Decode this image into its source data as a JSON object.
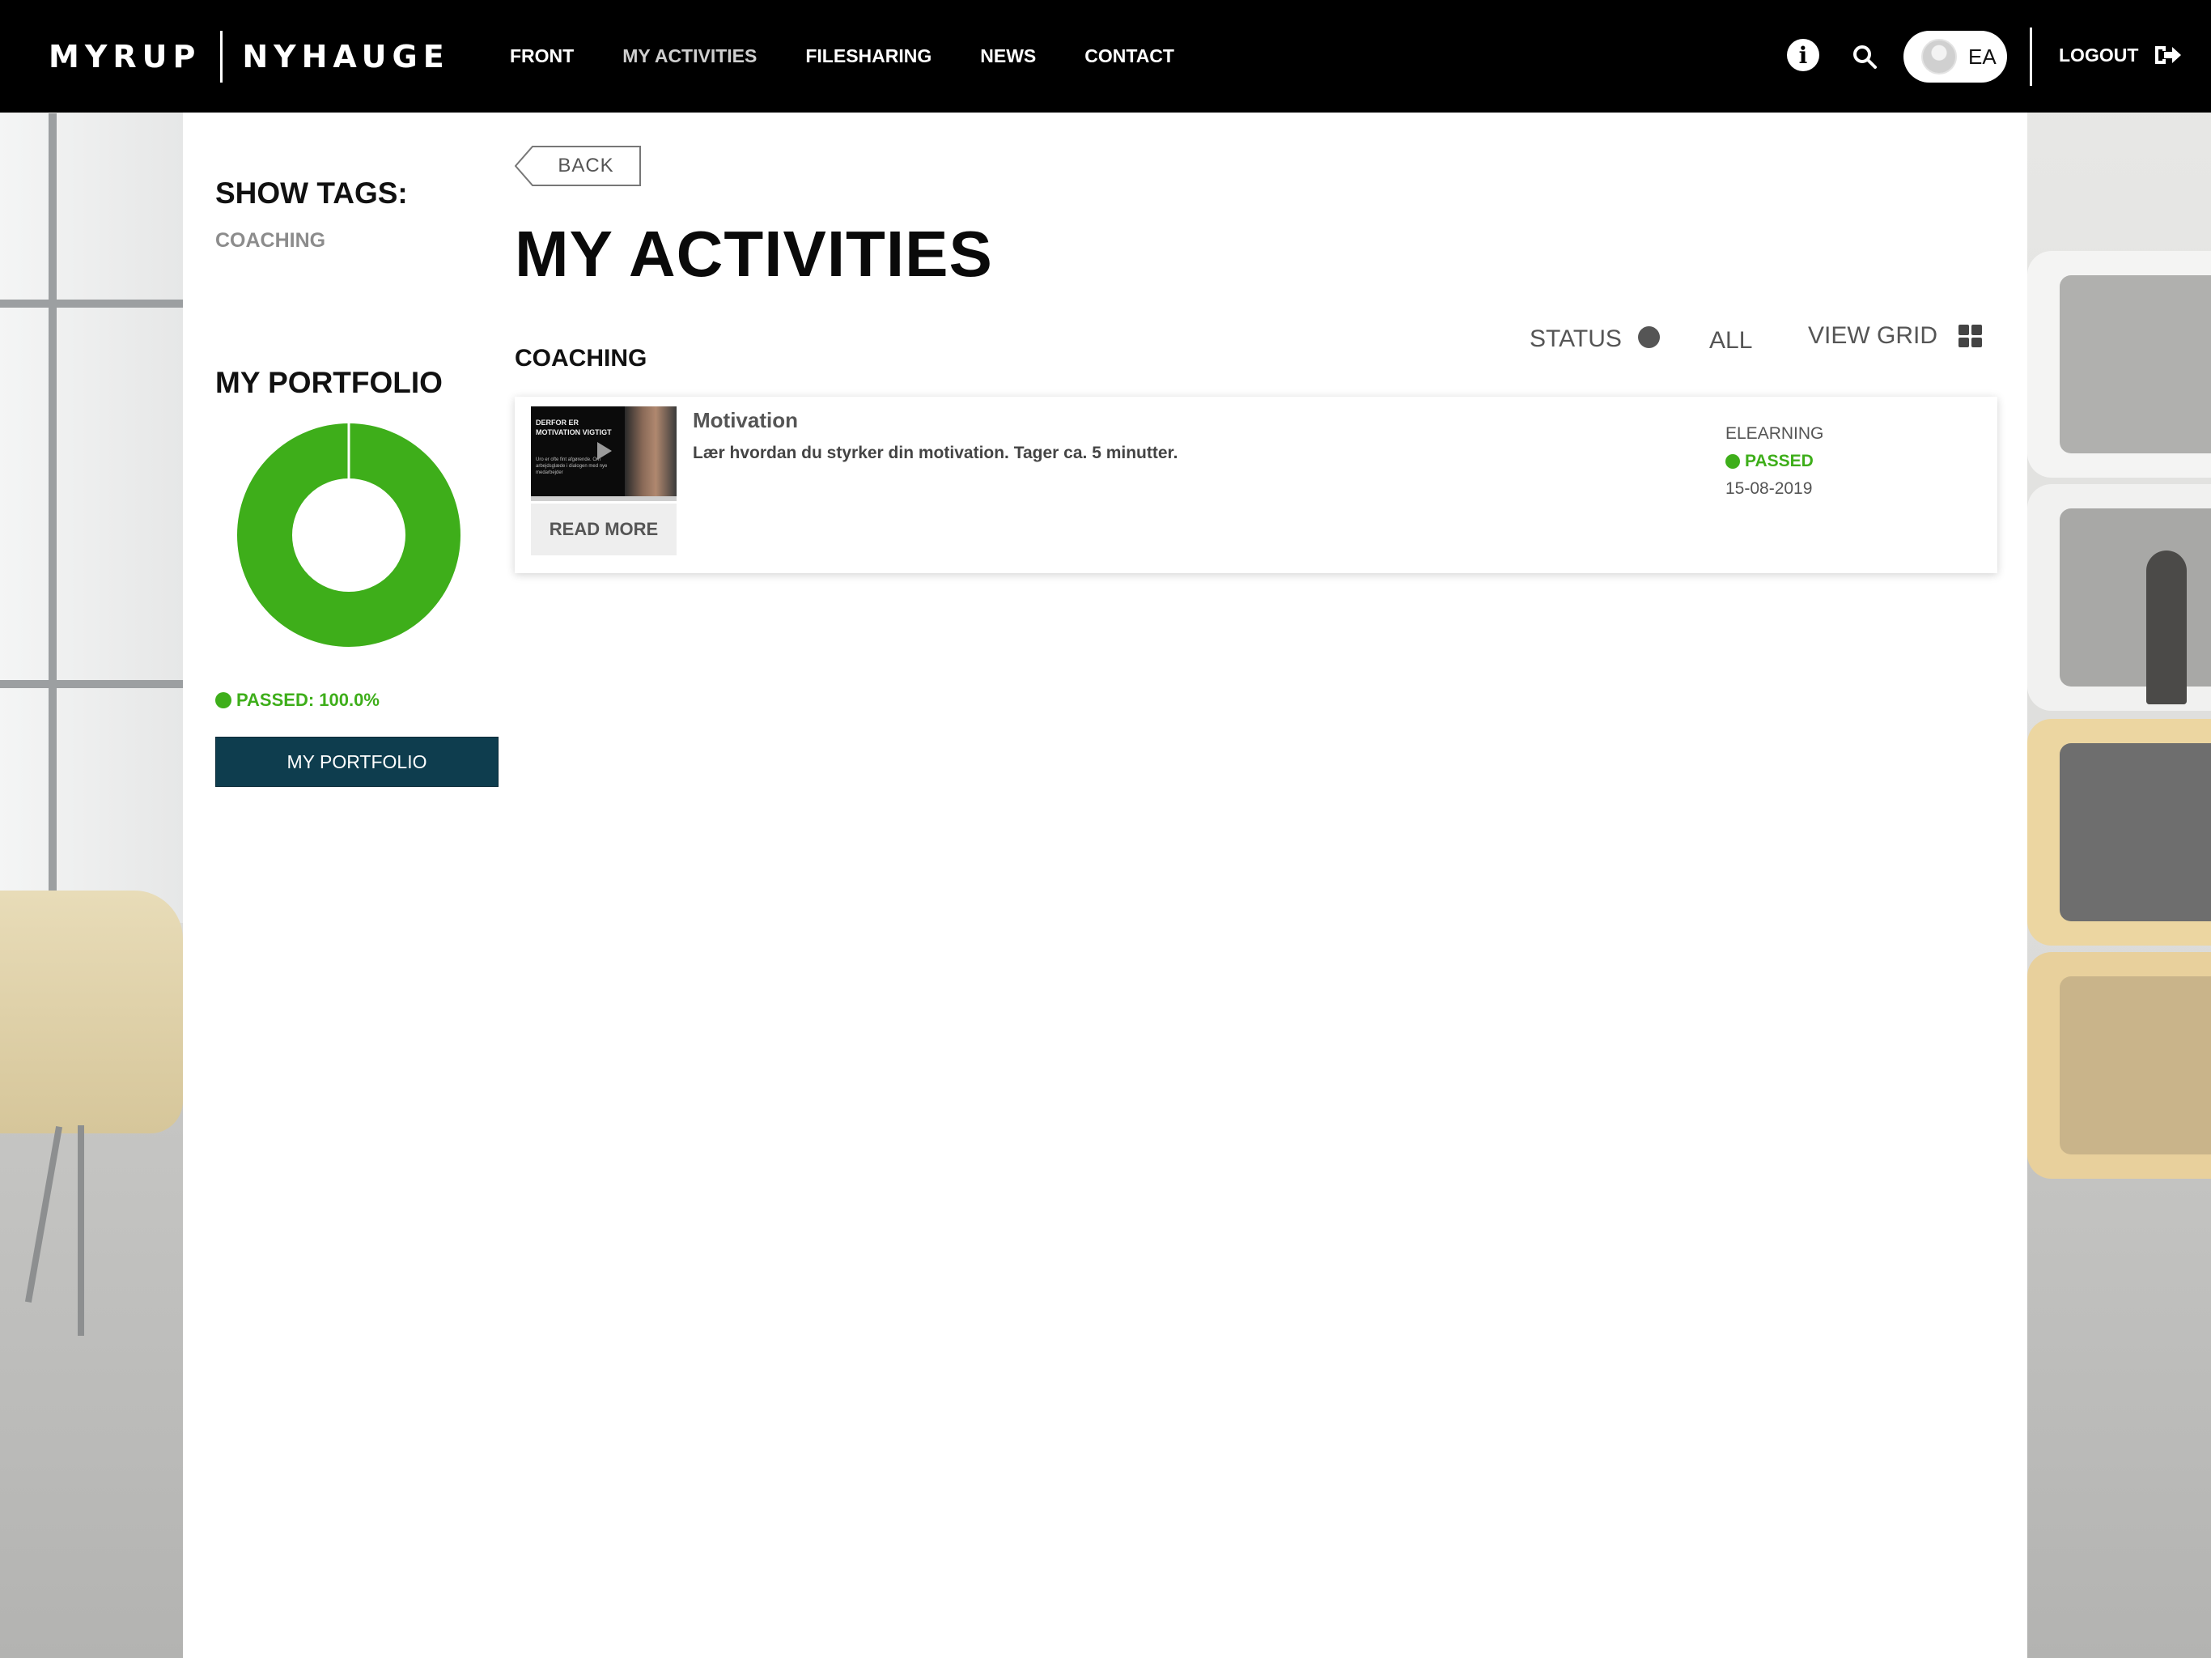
{
  "brand": {
    "left": "MYRUP",
    "right": "NYHAUGE"
  },
  "nav": {
    "items": [
      {
        "label": "FRONT",
        "active": false
      },
      {
        "label": "MY ACTIVITIES",
        "active": true
      },
      {
        "label": "FILESHARING",
        "active": false
      },
      {
        "label": "NEWS",
        "active": false
      },
      {
        "label": "CONTACT",
        "active": false
      }
    ],
    "user_initials": "EA",
    "logout_label": "LOGOUT"
  },
  "sidebar": {
    "show_tags_title": "SHOW TAGS:",
    "tags": [
      "COACHING"
    ],
    "portfolio_title": "MY PORTFOLIO",
    "portfolio_chart": {
      "passed_fraction": 1.0,
      "color": "#3eae1a"
    },
    "passed_label": "PASSED: 100.0%",
    "portfolio_button": "MY PORTFOLIO"
  },
  "main": {
    "back_label": "BACK",
    "title": "MY ACTIVITIES",
    "section": "COACHING",
    "filters": {
      "status_label": "STATUS",
      "all_label": "ALL",
      "view_grid_label": "VIEW GRID"
    },
    "activities": [
      {
        "title": "Motivation",
        "description": "Lær hvordan du styrker din motivation. Tager ca. 5 minutter.",
        "type": "ELEARNING",
        "status": "PASSED",
        "date": "15-08-2019",
        "read_more": "READ MORE",
        "thumbnail_text": "DERFOR ER MOTIVATION VIGTIGT",
        "thumbnail_subtext": "Uro er ofte fint afgørende. Om arbejdsglæde i dialogen med nye medarbejder"
      }
    ]
  },
  "colors": {
    "topbar": "#000000",
    "passed": "#3eae1a",
    "primary_button": "#0e3d4e"
  }
}
